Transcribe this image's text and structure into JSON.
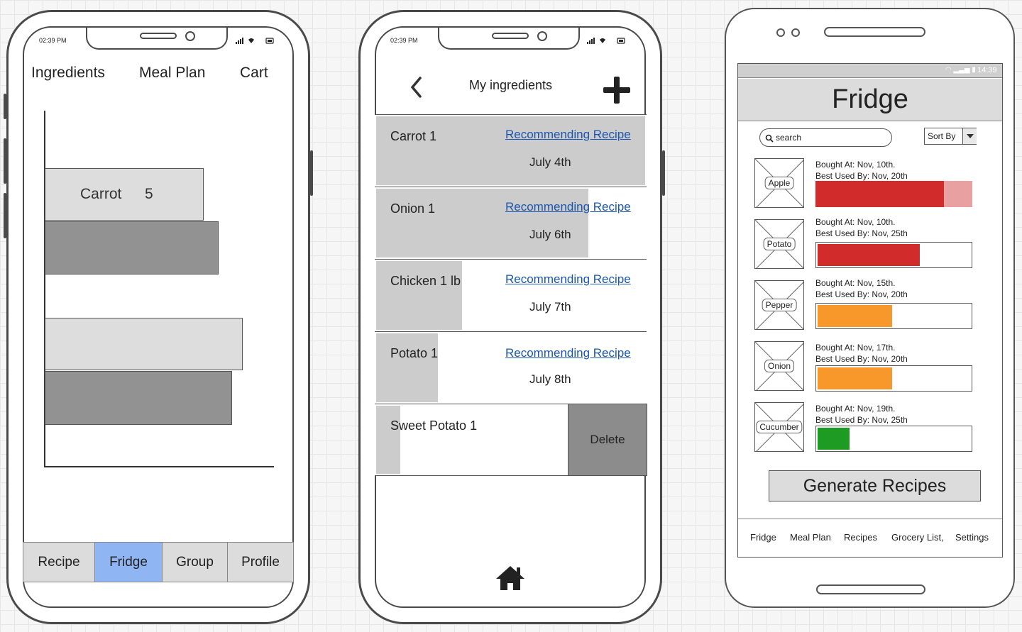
{
  "phone1": {
    "time": "02:39 PM",
    "top_tabs": [
      "Ingredients",
      "Meal Plan",
      "Cart"
    ],
    "chart_label_name": "Carrot",
    "chart_label_value": "5",
    "bottom_tabs": [
      {
        "label": "Recipe",
        "active": false
      },
      {
        "label": "Fridge",
        "active": true
      },
      {
        "label": "Group",
        "active": false
      },
      {
        "label": "Profile",
        "active": false
      }
    ]
  },
  "phone2": {
    "time": "02:39 PM",
    "title": "My ingredients",
    "items": [
      {
        "name": "Carrot 1",
        "link": "Recommending Recipe",
        "date": "July 4th",
        "fill": 1.0
      },
      {
        "name": "Onion 1",
        "link": "Recommending Recipe",
        "date": "July 6th",
        "fill": 0.79
      },
      {
        "name": "Chicken 1 lb",
        "link": "Recommending Recipe",
        "date": "July 7th",
        "fill": 0.32
      },
      {
        "name": "Potato 1",
        "link": "Recommending Recipe",
        "date": "July 8th",
        "fill": 0.23
      },
      {
        "name": "Sweet Potato 1",
        "fill": 0.09
      }
    ],
    "delete_label": "Delete"
  },
  "android": {
    "status_time": "14:39",
    "title": "Fridge",
    "search_placeholder": "search",
    "sort_label": "Sort By",
    "items": [
      {
        "name": "Apple",
        "bought": "Bought At: Nov, 10th.",
        "best": "Best Used By: Nov, 20th",
        "freshness": 0.82,
        "color": "#d12b2b"
      },
      {
        "name": "Potato",
        "bought": "Bought At: Nov, 10th.",
        "best": "Best Used By: Nov, 25th",
        "freshness": 0.67,
        "color": "#d12b2b"
      },
      {
        "name": "Pepper",
        "bought": "Bought At: Nov, 15th.",
        "best": "Best Used By: Nov, 20th",
        "freshness": 0.49,
        "color": "#f8982a"
      },
      {
        "name": "Onion",
        "bought": "Bought At: Nov, 17th.",
        "best": "Best Used By: Nov, 20th",
        "freshness": 0.49,
        "color": "#f8982a"
      },
      {
        "name": "Cucumber",
        "bought": "Bought At: Nov, 19th.",
        "best": "Best Used By: Nov, 25th",
        "freshness": 0.21,
        "color": "#1e9b22"
      }
    ],
    "generate_label": "Generate Recipes",
    "nav": [
      "Fridge",
      "Meal Plan",
      "Recipes",
      "Grocery List,",
      "Settings"
    ]
  },
  "colors": {
    "active_tab": "#8fb6f2",
    "link": "#1a56b0",
    "apple_remaining": "#e8a0a0"
  }
}
